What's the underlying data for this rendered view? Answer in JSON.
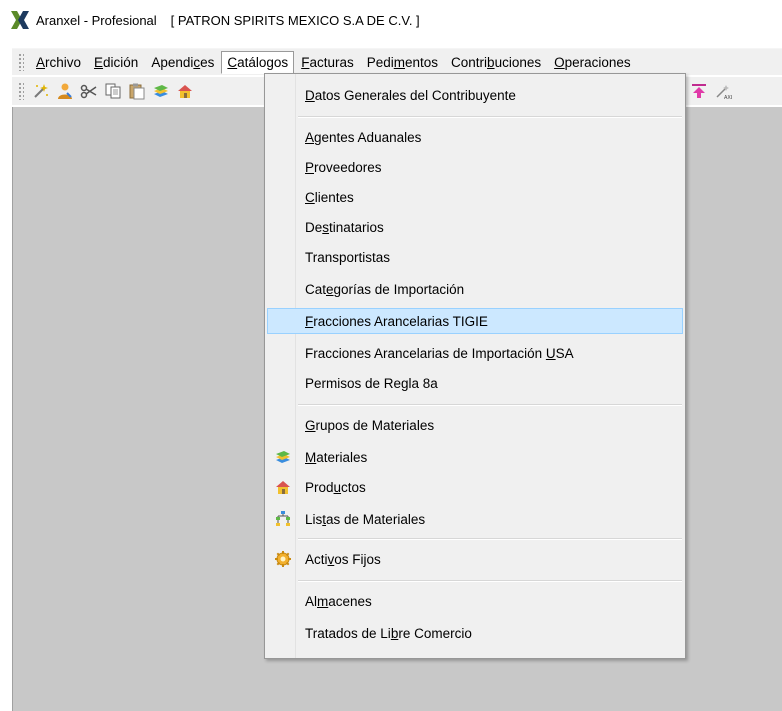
{
  "window": {
    "app_title": "Aranxel - Profesional",
    "company": "[ PATRON SPIRITS MEXICO S.A DE C.V. ]"
  },
  "menubar": {
    "items": [
      {
        "pre": "",
        "key": "A",
        "post": "rchivo"
      },
      {
        "pre": "",
        "key": "E",
        "post": "dición"
      },
      {
        "pre": "Apendi",
        "key": "c",
        "post": "es"
      },
      {
        "pre": "",
        "key": "C",
        "post": "atálogos"
      },
      {
        "pre": "",
        "key": "F",
        "post": "acturas"
      },
      {
        "pre": "Pedi",
        "key": "m",
        "post": "entos"
      },
      {
        "pre": "Contri",
        "key": "b",
        "post": "uciones"
      },
      {
        "pre": "",
        "key": "O",
        "post": "peraciones"
      }
    ]
  },
  "toolbar": {
    "icons": [
      "wand-icon",
      "user-icon",
      "scissors-icon",
      "copy-icon",
      "paste-icon",
      "layers-icon",
      "house-icon"
    ],
    "right_icons": [
      "upload-icon",
      "magic-icon"
    ]
  },
  "catalogos_menu": {
    "items": [
      {
        "pre": "",
        "key": "D",
        "post": "atos Generales del Contribuyente"
      },
      {
        "pre": "",
        "key": "A",
        "post": "gentes Aduanales"
      },
      {
        "pre": "",
        "key": "P",
        "post": "roveedores"
      },
      {
        "pre": "",
        "key": "C",
        "post": "lientes"
      },
      {
        "pre": "De",
        "key": "s",
        "post": "tinatarios"
      },
      {
        "pre": "Transportistas",
        "key": "",
        "post": ""
      },
      {
        "pre": "Cat",
        "key": "e",
        "post": "gorías de Importación"
      },
      {
        "pre": "",
        "key": "F",
        "post": "racciones Arancelarias TIGIE"
      },
      {
        "pre": "Fracciones Arancelarias de Importación ",
        "key": "U",
        "post": "SA"
      },
      {
        "pre": "Permisos de Regla 8a",
        "key": "",
        "post": ""
      },
      {
        "pre": "",
        "key": "G",
        "post": "rupos de Materiales"
      },
      {
        "pre": "",
        "key": "M",
        "post": "ateriales"
      },
      {
        "pre": "Prod",
        "key": "u",
        "post": "ctos"
      },
      {
        "pre": "Lis",
        "key": "t",
        "post": "as de Materiales"
      },
      {
        "pre": "Acti",
        "key": "v",
        "post": "os Fijos"
      },
      {
        "pre": "Al",
        "key": "m",
        "post": "acenes"
      },
      {
        "pre": "Tratados de Li",
        "key": "b",
        "post": "re Comercio"
      }
    ]
  },
  "colors": {
    "menu_bg": "#f0f0f0",
    "highlight_bg": "#cce8ff",
    "highlight_border": "#99d1ff",
    "client_bg": "#c8c8c8",
    "logo_green": "#5b8a2a",
    "logo_dark": "#1d3a5f"
  }
}
